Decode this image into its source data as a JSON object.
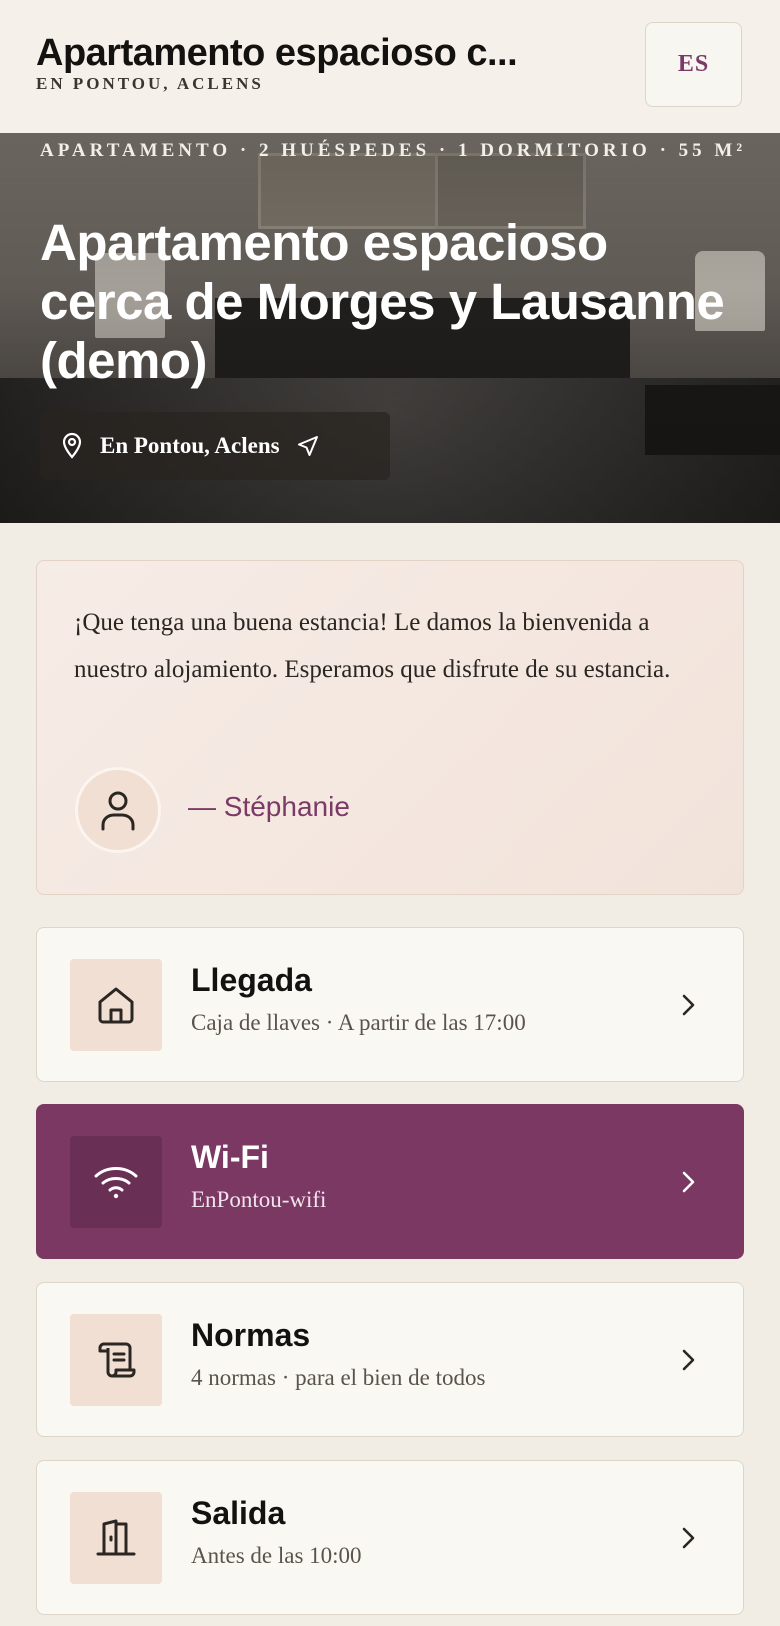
{
  "header": {
    "title": "Apartamento espacioso c...",
    "subtitle": "EN PONTOU, ACLENS",
    "language": "ES"
  },
  "hero": {
    "meta": "APARTAMENTO · 2 HUÉSPEDES · 1 DORMITORIO · 55 M²",
    "title": "Apartamento espacioso cerca de Morges y Lausanne (demo)",
    "location": "En Pontou, Aclens",
    "location_icon": "map-pin-icon",
    "navigate_icon": "navigation-arrow-icon"
  },
  "welcome": {
    "message": "¡Que tenga una buena estancia! Le damos la bienvenida a nuestro alojamiento. Esperamos que disfrute de su estancia.",
    "signature": "— Stéphanie",
    "avatar_icon": "user-icon"
  },
  "sections": [
    {
      "title": "Llegada",
      "subtitle": "Caja de llaves · A partir de las 17:00",
      "icon": "home-icon"
    },
    {
      "title": "Wi-Fi",
      "subtitle": "EnPontou-wifi",
      "icon": "wifi-icon"
    },
    {
      "title": "Normas",
      "subtitle": "4 normas · para el bien de todos",
      "icon": "scroll-icon"
    },
    {
      "title": "Salida",
      "subtitle": "Antes de las 10:00",
      "icon": "door-icon"
    }
  ],
  "colors": {
    "accent": "#7a3863",
    "background": "#f2ede4",
    "icon_tile": "#f1dfd3"
  }
}
